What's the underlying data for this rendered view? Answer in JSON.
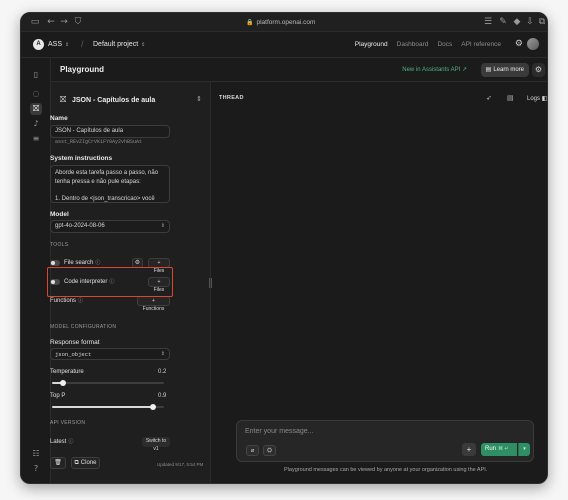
{
  "browser": {
    "url": "platform.openai.com"
  },
  "topnav": {
    "org_badge": "A",
    "org_name": "ASS",
    "project_name": "Default project",
    "links": [
      "Playground",
      "Dashboard",
      "Docs",
      "API reference"
    ],
    "active_link": "Playground"
  },
  "header": {
    "title": "Playground",
    "new_link": "New in Assistants API ↗",
    "learn_more": "Learn more"
  },
  "assistant": {
    "selector_name": "JSON - Capítulos de aula",
    "name_label": "Name",
    "name_value": "JSON - Capítulos de aula",
    "assistant_id": "asst_REvZIgCrVK1FY0Ay2vhBSuAt",
    "instructions_label": "System instructions",
    "instructions_value": "Aborde esta tarefa passo a passo, não tenha pressa e não pule etapas:\n\n1. Dentro de <json_transcricao> você tem um JSON contendo segmentos de transcrição de",
    "model_label": "Model",
    "model_value": "gpt-4o-2024-08-06",
    "tools_section": "TOOLS",
    "tools": [
      {
        "name": "File search",
        "button": "+ Files"
      },
      {
        "name": "Code interpreter",
        "button": "+ Files"
      }
    ],
    "functions_label": "Functions",
    "functions_button": "+ Functions",
    "model_config_section": "MODEL CONFIGURATION",
    "response_format_label": "Response format",
    "response_format_value": "json_object",
    "temperature_label": "Temperature",
    "temperature_value": "0.2",
    "top_p_label": "Top P",
    "top_p_value": "0.9",
    "api_version_section": "API VERSION",
    "api_version_label": "Latest",
    "switch_button": "Switch to v1",
    "clone_button": "Clone",
    "updated_text": "Updated 9/17, 5:54 PM"
  },
  "slider_levels": {
    "temperature": 0.1,
    "top_p": 0.9
  },
  "thread": {
    "title": "THREAD",
    "logs_label": "Logs",
    "input_placeholder": "Enter your message...",
    "run_label": "Run",
    "run_shortcut": "⌘ ↵",
    "notice": "Playground messages can be viewed by anyone at your organization using the API."
  },
  "colors": {
    "accent_green": "#2f8f64",
    "highlight_red": "#d9472f",
    "link_green": "#4fb286"
  }
}
